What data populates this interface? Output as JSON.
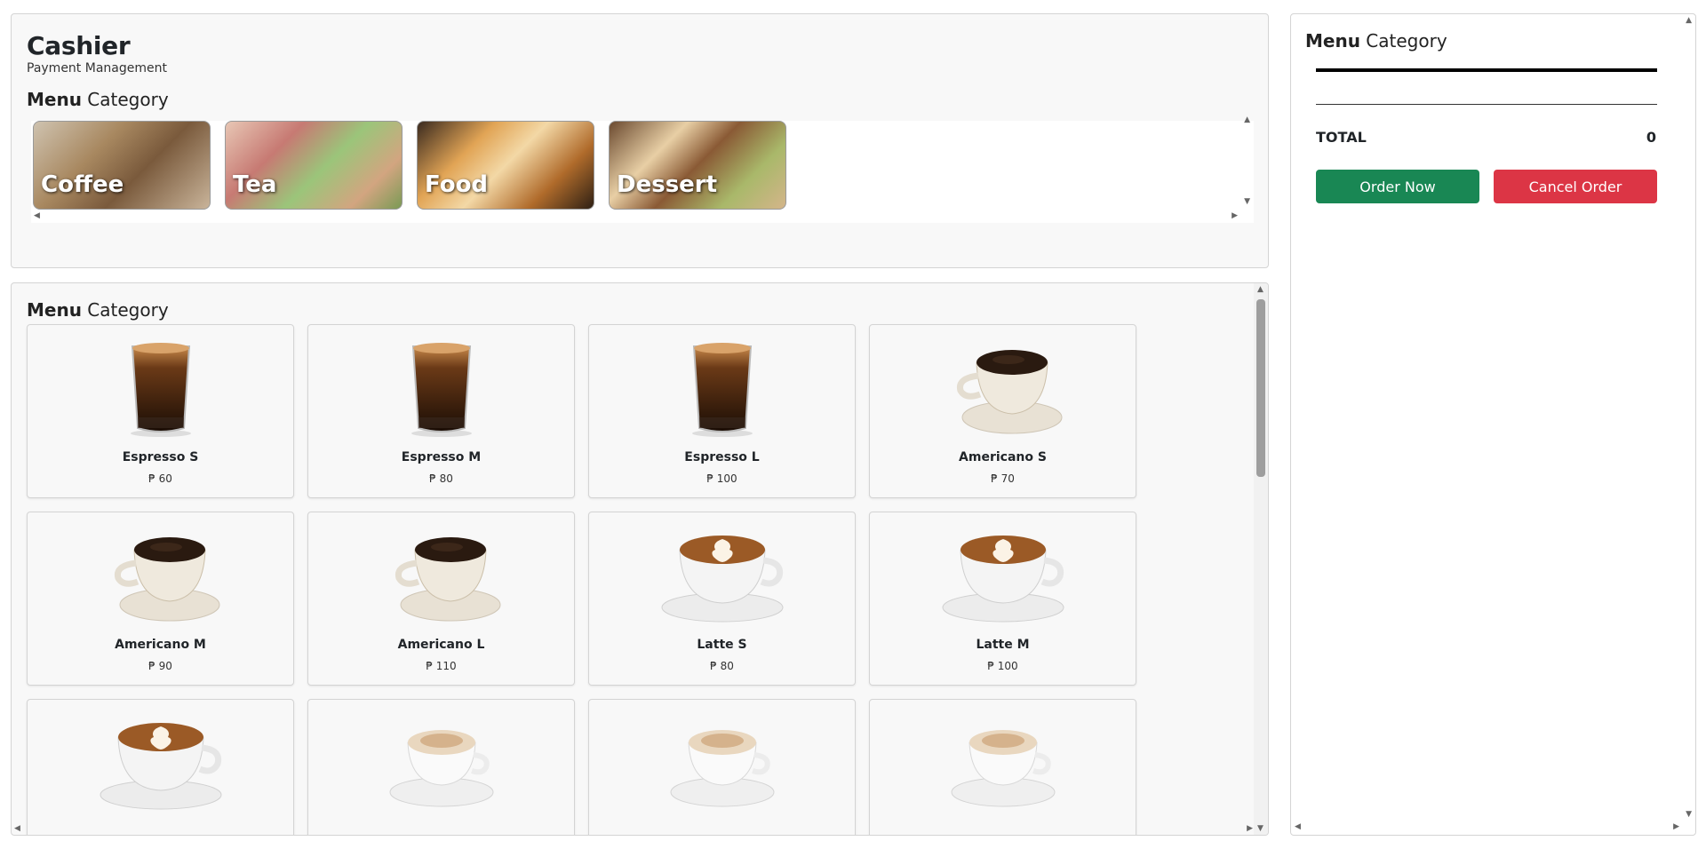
{
  "header": {
    "title": "Cashier",
    "subtitle": "Payment Management"
  },
  "categories_section": {
    "title_bold": "Menu",
    "title_rest": " Category",
    "items": [
      {
        "label": "Coffee"
      },
      {
        "label": "Tea"
      },
      {
        "label": "Food"
      },
      {
        "label": "Dessert"
      }
    ]
  },
  "menu_section": {
    "title_bold": "Menu",
    "title_rest": " Category",
    "items": [
      {
        "name": "Espresso S",
        "price": "₱ 60",
        "image": "espresso-glass"
      },
      {
        "name": "Espresso M",
        "price": "₱ 80",
        "image": "espresso-glass"
      },
      {
        "name": "Espresso L",
        "price": "₱ 100",
        "image": "espresso-glass"
      },
      {
        "name": "Americano S",
        "price": "₱ 70",
        "image": "americano-cup"
      },
      {
        "name": "Americano M",
        "price": "₱ 90",
        "image": "americano-cup"
      },
      {
        "name": "Americano L",
        "price": "₱ 110",
        "image": "americano-cup"
      },
      {
        "name": "Latte S",
        "price": "₱ 80",
        "image": "latte-art-cup"
      },
      {
        "name": "Latte M",
        "price": "₱ 100",
        "image": "latte-art-cup"
      },
      {
        "name": "",
        "price": "",
        "image": "latte-art-cup"
      },
      {
        "name": "",
        "price": "",
        "image": "cappuccino-cup"
      },
      {
        "name": "",
        "price": "",
        "image": "cappuccino-cup"
      },
      {
        "name": "",
        "price": "",
        "image": "cappuccino-cup"
      }
    ]
  },
  "order": {
    "title_bold": "Menu",
    "title_rest": " Category",
    "total_label": "TOTAL",
    "total_value": "0",
    "order_button": "Order Now",
    "cancel_button": "Cancel Order"
  },
  "colors": {
    "order_button": "#198754",
    "cancel_button": "#dc3545"
  }
}
